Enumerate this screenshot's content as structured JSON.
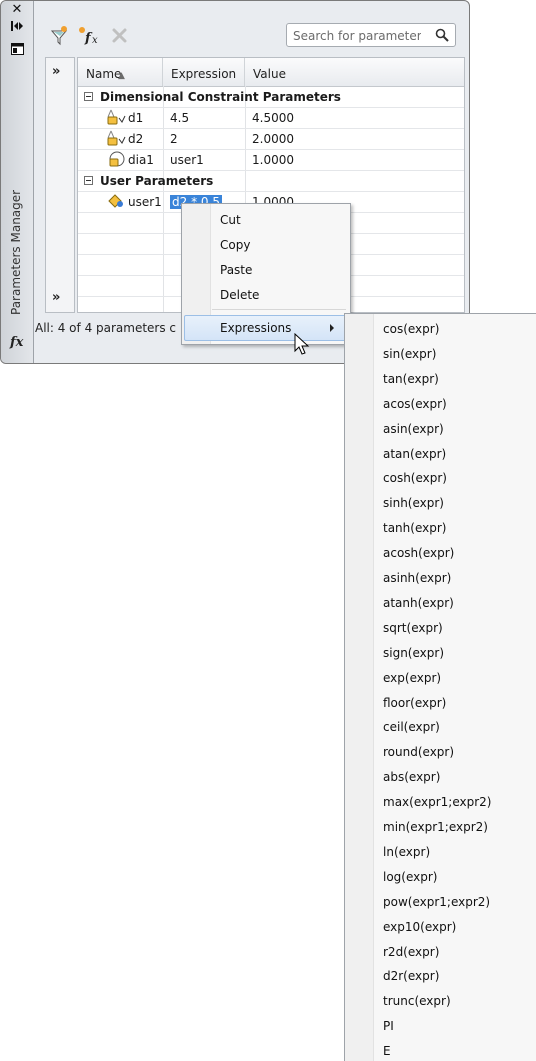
{
  "palette": {
    "title": "Parameters Manager",
    "search_placeholder": "Search for parameter",
    "status_text": "All: 4 of 4 parameters c"
  },
  "grid": {
    "columns": [
      "Name",
      "Expression",
      "Value"
    ],
    "groups": [
      {
        "label": "Dimensional Constraint Parameters",
        "rows": [
          {
            "name": "d1",
            "expression": "4.5",
            "value": "4.5000",
            "icon": "dimension-lock-icon"
          },
          {
            "name": "d2",
            "expression": "2",
            "value": "2.0000",
            "icon": "dimension-lock-icon"
          },
          {
            "name": "dia1",
            "expression": "user1",
            "value": "1.0000",
            "icon": "diameter-lock-icon"
          }
        ]
      },
      {
        "label": "User Parameters",
        "rows": [
          {
            "name": "user1",
            "expression": "d2 * 0.5",
            "value": "1.0000",
            "icon": "user-parameter-icon"
          }
        ]
      }
    ]
  },
  "context_menu": {
    "items": [
      "Cut",
      "Copy",
      "Paste",
      "Delete"
    ],
    "expressions_label": "Expressions"
  },
  "expressions_submenu": [
    "cos(expr)",
    "sin(expr)",
    "tan(expr)",
    "acos(expr)",
    "asin(expr)",
    "atan(expr)",
    "cosh(expr)",
    "sinh(expr)",
    "tanh(expr)",
    "acosh(expr)",
    "asinh(expr)",
    "atanh(expr)",
    "sqrt(expr)",
    "sign(expr)",
    "exp(expr)",
    "floor(expr)",
    "ceil(expr)",
    "round(expr)",
    "abs(expr)",
    "max(expr1;expr2)",
    "min(expr1;expr2)",
    "ln(expr)",
    "log(expr)",
    "pow(expr1;expr2)",
    "exp10(expr)",
    "r2d(expr)",
    "d2r(expr)",
    "trunc(expr)",
    "PI",
    "E"
  ],
  "colors": {
    "selection": "#3a84d9",
    "menu_highlight": "#d4e4f7",
    "palette_bg": "#e9ecf0"
  }
}
